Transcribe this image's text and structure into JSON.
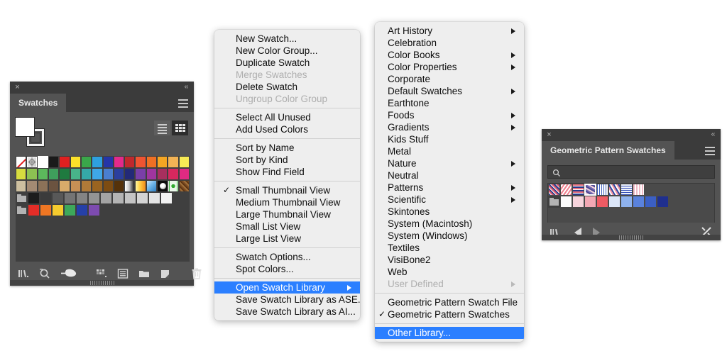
{
  "swatches_panel": {
    "title": "Swatches",
    "close_icon": "×",
    "collapse_icon": "‹‹",
    "menu_icon": "hamburger-icon",
    "view_list_label": "List View",
    "view_grid_label": "Grid View",
    "footer_icons": [
      "swatch-libraries-menu-icon",
      "show-swatch-kinds-menu-icon",
      "swatch-options-icon",
      "new-color-group-icon",
      "new-swatch-icon",
      "delete-swatch-icon"
    ],
    "rows": [
      {
        "type": "colors",
        "cells": [
          {
            "kind": "none",
            "color": "#ffffff"
          },
          {
            "kind": "registration",
            "color": "#ffffff"
          },
          {
            "kind": "color",
            "color": "#ffffff",
            "selected": true
          },
          {
            "kind": "color",
            "color": "#1a1a1a"
          },
          {
            "kind": "color",
            "color": "#e02020"
          },
          {
            "kind": "color",
            "color": "#fbe12a"
          },
          {
            "kind": "color",
            "color": "#3aa74a"
          },
          {
            "kind": "color",
            "color": "#2ea0e0"
          },
          {
            "kind": "color",
            "color": "#2535a8"
          },
          {
            "kind": "color",
            "color": "#e42a8b"
          },
          {
            "kind": "color",
            "color": "#c0282d"
          },
          {
            "kind": "color",
            "color": "#ef5432"
          },
          {
            "kind": "color",
            "color": "#ef7024"
          },
          {
            "kind": "color",
            "color": "#f5a623"
          },
          {
            "kind": "color",
            "color": "#f2b355"
          },
          {
            "kind": "color",
            "color": "#f7ea55"
          }
        ]
      },
      {
        "type": "colors",
        "cells": [
          {
            "kind": "color",
            "color": "#d7dc3f"
          },
          {
            "kind": "color",
            "color": "#8cc152"
          },
          {
            "kind": "color",
            "color": "#5cb85c"
          },
          {
            "kind": "color",
            "color": "#3f9e5c"
          },
          {
            "kind": "color",
            "color": "#1f7a3f"
          },
          {
            "kind": "color",
            "color": "#48b48a"
          },
          {
            "kind": "color",
            "color": "#35a8a8"
          },
          {
            "kind": "color",
            "color": "#3fa8e8"
          },
          {
            "kind": "color",
            "color": "#4a7fd0"
          },
          {
            "kind": "color",
            "color": "#2b3f9e"
          },
          {
            "kind": "color",
            "color": "#232a78"
          },
          {
            "kind": "color",
            "color": "#7a3fa8"
          },
          {
            "kind": "color",
            "color": "#a0359e"
          },
          {
            "kind": "color",
            "color": "#a82f5e"
          },
          {
            "kind": "color",
            "color": "#d6285e"
          },
          {
            "kind": "color",
            "color": "#e02a82"
          }
        ]
      },
      {
        "type": "colors",
        "cells": [
          {
            "kind": "color",
            "color": "#cdbfa0"
          },
          {
            "kind": "color",
            "color": "#a38a73"
          },
          {
            "kind": "color",
            "color": "#8c7258"
          },
          {
            "kind": "color",
            "color": "#6b5340"
          },
          {
            "kind": "color",
            "color": "#d8ab6a"
          },
          {
            "kind": "color",
            "color": "#c79055"
          },
          {
            "kind": "color",
            "color": "#b07a38"
          },
          {
            "kind": "color",
            "color": "#9a6420"
          },
          {
            "kind": "color",
            "color": "#7d4c12"
          },
          {
            "kind": "color",
            "color": "#55320a"
          },
          {
            "kind": "gradient",
            "color": "#ffffff",
            "name": "white-black-gradient"
          },
          {
            "kind": "gradient",
            "color": "#ffd24a",
            "name": "yellow-orange-gradient"
          },
          {
            "kind": "gradient",
            "color": "#6fb6e8",
            "name": "blue-gradient"
          },
          {
            "kind": "pattern",
            "color": "#0d0d0d",
            "name": "dot-pattern"
          },
          {
            "kind": "pattern",
            "color": "#3fb13f",
            "name": "green-pattern"
          },
          {
            "kind": "pattern",
            "color": "#7a4a22",
            "name": "brown-pattern"
          }
        ]
      },
      {
        "type": "group",
        "folder": true,
        "cells": [
          {
            "kind": "color",
            "color": "#1d1d1d"
          },
          {
            "kind": "color",
            "color": "#3b3b3b"
          },
          {
            "kind": "color",
            "color": "#585858"
          },
          {
            "kind": "color",
            "color": "#747474"
          },
          {
            "kind": "color",
            "color": "#848484"
          },
          {
            "kind": "color",
            "color": "#949494"
          },
          {
            "kind": "color",
            "color": "#a4a4a4"
          },
          {
            "kind": "color",
            "color": "#b4b4b4"
          },
          {
            "kind": "color",
            "color": "#c4c4c4"
          },
          {
            "kind": "color",
            "color": "#d4d4d4"
          },
          {
            "kind": "color",
            "color": "#e4e4e4"
          },
          {
            "kind": "color",
            "color": "#f2f2f2"
          }
        ]
      },
      {
        "type": "group",
        "folder": true,
        "cells": [
          {
            "kind": "color",
            "color": "#e32d27"
          },
          {
            "kind": "color",
            "color": "#ee7623"
          },
          {
            "kind": "color",
            "color": "#f5cb2e"
          },
          {
            "kind": "color",
            "color": "#3da85a"
          },
          {
            "kind": "color",
            "color": "#2540a8"
          },
          {
            "kind": "color",
            "color": "#7d4bb0"
          }
        ]
      }
    ]
  },
  "menu_main": {
    "items": [
      {
        "label": "New Swatch...",
        "state": "normal"
      },
      {
        "label": "New Color Group...",
        "state": "normal"
      },
      {
        "label": "Duplicate Swatch",
        "state": "normal"
      },
      {
        "label": "Merge Swatches",
        "state": "disabled"
      },
      {
        "label": "Delete Swatch",
        "state": "normal"
      },
      {
        "label": "Ungroup Color Group",
        "state": "disabled"
      },
      {
        "separator": true
      },
      {
        "label": "Select All Unused",
        "state": "normal"
      },
      {
        "label": "Add Used Colors",
        "state": "normal"
      },
      {
        "separator": true
      },
      {
        "label": "Sort by Name",
        "state": "normal"
      },
      {
        "label": "Sort by Kind",
        "state": "normal"
      },
      {
        "label": "Show Find Field",
        "state": "normal"
      },
      {
        "separator": true
      },
      {
        "label": "Small Thumbnail View",
        "state": "normal",
        "checked": true
      },
      {
        "label": "Medium Thumbnail View",
        "state": "normal"
      },
      {
        "label": "Large Thumbnail View",
        "state": "normal"
      },
      {
        "label": "Small List View",
        "state": "normal"
      },
      {
        "label": "Large List View",
        "state": "normal"
      },
      {
        "separator": true
      },
      {
        "label": "Swatch Options...",
        "state": "normal"
      },
      {
        "label": "Spot Colors...",
        "state": "normal"
      },
      {
        "separator": true
      },
      {
        "label": "Open Swatch Library",
        "state": "highlighted",
        "submenu": true
      },
      {
        "label": "Save Swatch Library as ASE...",
        "state": "normal"
      },
      {
        "label": "Save Swatch Library as AI...",
        "state": "normal"
      }
    ]
  },
  "menu_sub": {
    "items": [
      {
        "label": "Art History",
        "state": "normal",
        "submenu": true
      },
      {
        "label": "Celebration",
        "state": "normal"
      },
      {
        "label": "Color Books",
        "state": "normal",
        "submenu": true
      },
      {
        "label": "Color Properties",
        "state": "normal",
        "submenu": true
      },
      {
        "label": "Corporate",
        "state": "normal"
      },
      {
        "label": "Default Swatches",
        "state": "normal",
        "submenu": true
      },
      {
        "label": "Earthtone",
        "state": "normal"
      },
      {
        "label": "Foods",
        "state": "normal",
        "submenu": true
      },
      {
        "label": "Gradients",
        "state": "normal",
        "submenu": true
      },
      {
        "label": "Kids Stuff",
        "state": "normal"
      },
      {
        "label": "Metal",
        "state": "normal"
      },
      {
        "label": "Nature",
        "state": "normal",
        "submenu": true
      },
      {
        "label": "Neutral",
        "state": "normal"
      },
      {
        "label": "Patterns",
        "state": "normal",
        "submenu": true
      },
      {
        "label": "Scientific",
        "state": "normal",
        "submenu": true
      },
      {
        "label": "Skintones",
        "state": "normal"
      },
      {
        "label": "System (Macintosh)",
        "state": "normal"
      },
      {
        "label": "System (Windows)",
        "state": "normal"
      },
      {
        "label": "Textiles",
        "state": "normal"
      },
      {
        "label": "VisiBone2",
        "state": "normal"
      },
      {
        "label": "Web",
        "state": "normal"
      },
      {
        "label": "User Defined",
        "state": "disabled",
        "submenu": true
      },
      {
        "separator": true
      },
      {
        "label": "Geometric Pattern Swatch File",
        "state": "normal"
      },
      {
        "label": "Geometric Pattern Swatches",
        "state": "normal",
        "checked": true
      },
      {
        "separator": true
      },
      {
        "label": "Other Library...",
        "state": "highlighted"
      }
    ]
  },
  "geo_panel": {
    "title": "Geometric Pattern Swatches",
    "close_icon": "×",
    "collapse_icon": "‹‹",
    "menu_icon": "hamburger-icon",
    "search_placeholder": "",
    "search_value": "",
    "search_icon": "magnifier-icon",
    "footer_icons": [
      "swatch-libraries-menu-icon",
      "previous-library-icon",
      "next-library-icon",
      "unlink-icon"
    ],
    "rows": [
      {
        "type": "patterns",
        "cells": [
          {
            "kind": "pattern",
            "name": "geo-pattern-1",
            "css": "p1"
          },
          {
            "kind": "pattern",
            "name": "geo-pattern-2",
            "css": "p2"
          },
          {
            "kind": "pattern",
            "name": "geo-pattern-3",
            "css": "p3"
          },
          {
            "kind": "pattern",
            "name": "geo-pattern-4",
            "css": "p4",
            "selected": true
          },
          {
            "kind": "pattern",
            "name": "geo-pattern-5",
            "css": "p5"
          },
          {
            "kind": "pattern",
            "name": "geo-pattern-6",
            "css": "p6"
          },
          {
            "kind": "pattern",
            "name": "geo-pattern-7",
            "css": "p7"
          },
          {
            "kind": "pattern",
            "name": "geo-pattern-8",
            "css": "p8"
          }
        ]
      },
      {
        "type": "group",
        "folder": true,
        "cells": [
          {
            "kind": "color",
            "color": "#fdfdfd"
          },
          {
            "kind": "color",
            "color": "#f6d4dc"
          },
          {
            "kind": "color",
            "color": "#f2a8b4"
          },
          {
            "kind": "color",
            "color": "#ef5b64"
          },
          {
            "kind": "color",
            "color": "#dbe6f8"
          },
          {
            "kind": "color",
            "color": "#8fb2ee"
          },
          {
            "kind": "color",
            "color": "#5a82dd"
          },
          {
            "kind": "color",
            "color": "#3b5fc4"
          },
          {
            "kind": "color",
            "color": "#1f2f8e"
          }
        ]
      }
    ]
  },
  "colors": {
    "panel_bg": "#535353",
    "panel_header_bg": "#3b3b3b",
    "menu_bg": "#eeeeee",
    "menu_highlight": "#2b7fff",
    "menu_text": "#0d0d0d",
    "menu_disabled_text": "#aeaeae",
    "page_bg": "#ffffff"
  }
}
